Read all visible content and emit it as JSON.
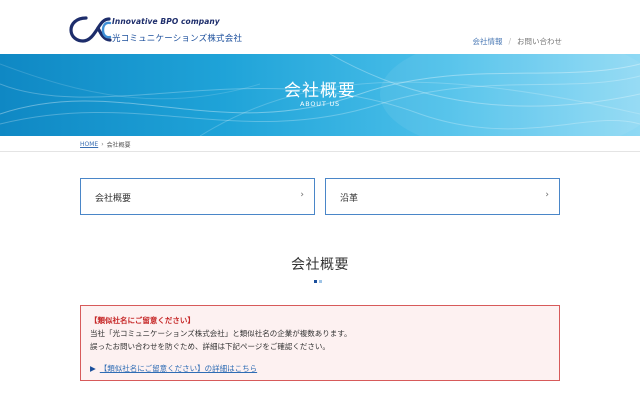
{
  "header": {
    "logo_icon": "alpha-c-logo",
    "tagline": "Innovative BPO company",
    "company_name": "光コミュニケーションズ株式会社",
    "nav": [
      {
        "label": "会社情報"
      },
      {
        "label": "お問い合わせ"
      }
    ],
    "nav_separator": "/"
  },
  "hero": {
    "title": "会社概要",
    "subtitle": "ABOUT US"
  },
  "breadcrumb": {
    "home": "HOME",
    "separator": "›",
    "current": "会社概要"
  },
  "cards": [
    {
      "label": "会社概要",
      "arrow": "›"
    },
    {
      "label": "沿革",
      "arrow": "›"
    }
  ],
  "section": {
    "title": "会社概要"
  },
  "notice": {
    "title": "【類似社名にご留意ください】",
    "line1": "当社「光コミュニケーションズ株式会社」と類似社名の企業が複数あります。",
    "line2": "誤ったお問い合わせを防ぐため、詳細は下記ページをご確認ください。",
    "link_marker": "▶",
    "link_text": "【類似社名にご留意ください】の詳細はこちら"
  },
  "colors": {
    "brand_navy": "#1d2d6b",
    "brand_blue": "#1b4f9c",
    "hero_blue": "#1fa3d8",
    "card_border": "#4a86c8",
    "notice_border": "#d75a5a",
    "notice_bg": "#fdf1f1",
    "notice_title": "#c62828"
  }
}
